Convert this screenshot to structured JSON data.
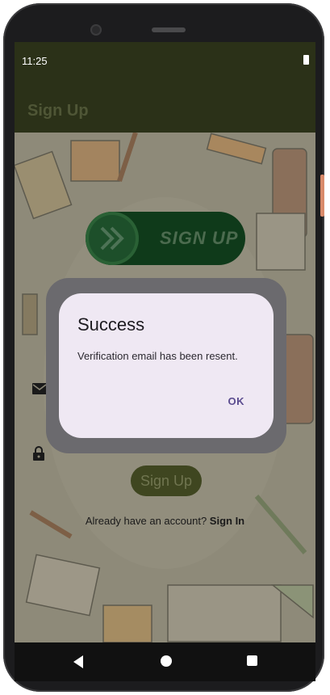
{
  "status_bar": {
    "time": "11:25"
  },
  "app_bar": {
    "title": "Sign Up"
  },
  "logo": {
    "text": "SIGN UP"
  },
  "form": {
    "sign_up_button": "Sign Up",
    "account_prompt": "Already have an account?",
    "sign_in_link": "Sign In"
  },
  "dialog": {
    "title": "Success",
    "message": "Verification email has been resent.",
    "ok_button": "OK"
  },
  "icons": {
    "battery": "battery-icon",
    "email": "email-icon",
    "lock": "lock-icon",
    "back": "back-icon",
    "home": "home-icon",
    "recents": "recents-icon"
  },
  "colors": {
    "app_bar": "#2b3118",
    "dialog_bg": "#efe8f3",
    "accent": "#5b4c8f"
  }
}
